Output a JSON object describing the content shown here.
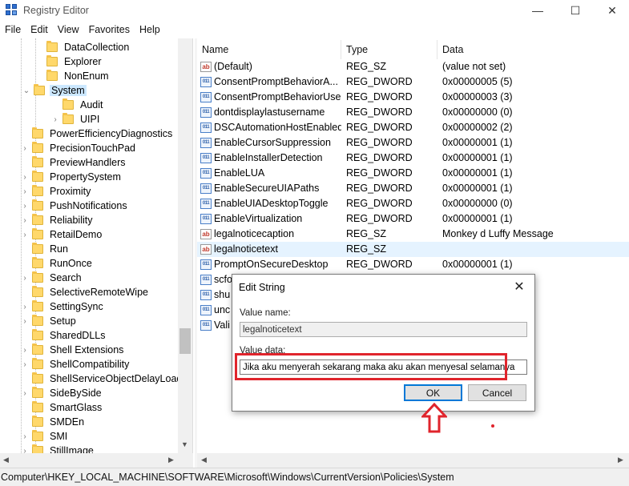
{
  "window": {
    "title": "Registry Editor",
    "minimize_glyph": "—",
    "maximize_glyph": "☐",
    "close_glyph": "✕"
  },
  "menu": [
    "File",
    "Edit",
    "View",
    "Favorites",
    "Help"
  ],
  "tree": {
    "items": [
      {
        "label": "DataCollection",
        "chevron": "",
        "selected": false
      },
      {
        "label": "Explorer",
        "chevron": "",
        "selected": false
      },
      {
        "label": "NonEnum",
        "chevron": "",
        "selected": false
      },
      {
        "label": "System",
        "chevron": "⌄",
        "selected": true
      },
      {
        "label": "Audit",
        "chevron": "",
        "selected": false
      },
      {
        "label": "UIPI",
        "chevron": "›",
        "selected": false
      },
      {
        "label": "PowerEfficiencyDiagnostics",
        "chevron": "",
        "selected": false
      },
      {
        "label": "PrecisionTouchPad",
        "chevron": "›",
        "selected": false
      },
      {
        "label": "PreviewHandlers",
        "chevron": "",
        "selected": false
      },
      {
        "label": "PropertySystem",
        "chevron": "›",
        "selected": false
      },
      {
        "label": "Proximity",
        "chevron": "›",
        "selected": false
      },
      {
        "label": "PushNotifications",
        "chevron": "›",
        "selected": false
      },
      {
        "label": "Reliability",
        "chevron": "›",
        "selected": false
      },
      {
        "label": "RetailDemo",
        "chevron": "›",
        "selected": false
      },
      {
        "label": "Run",
        "chevron": "",
        "selected": false
      },
      {
        "label": "RunOnce",
        "chevron": "",
        "selected": false
      },
      {
        "label": "Search",
        "chevron": "›",
        "selected": false
      },
      {
        "label": "SelectiveRemoteWipe",
        "chevron": "",
        "selected": false
      },
      {
        "label": "SettingSync",
        "chevron": "›",
        "selected": false
      },
      {
        "label": "Setup",
        "chevron": "›",
        "selected": false
      },
      {
        "label": "SharedDLLs",
        "chevron": "",
        "selected": false
      },
      {
        "label": "Shell Extensions",
        "chevron": "›",
        "selected": false
      },
      {
        "label": "ShellCompatibility",
        "chevron": "›",
        "selected": false
      },
      {
        "label": "ShellServiceObjectDelayLoad",
        "chevron": "",
        "selected": false
      },
      {
        "label": "SideBySide",
        "chevron": "›",
        "selected": false
      },
      {
        "label": "SmartGlass",
        "chevron": "",
        "selected": false
      },
      {
        "label": "SMDEn",
        "chevron": "",
        "selected": false
      },
      {
        "label": "SMI",
        "chevron": "›",
        "selected": false
      },
      {
        "label": "StillImage",
        "chevron": "›",
        "selected": false
      }
    ]
  },
  "list": {
    "columns": [
      "Name",
      "Type",
      "Data"
    ],
    "rows": [
      {
        "name": "(Default)",
        "kind": "sz",
        "type": "REG_SZ",
        "data": "(value not set)",
        "selected": false
      },
      {
        "name": "ConsentPromptBehaviorA...",
        "kind": "dword",
        "type": "REG_DWORD",
        "data": "0x00000005 (5)",
        "selected": false
      },
      {
        "name": "ConsentPromptBehaviorUser",
        "kind": "dword",
        "type": "REG_DWORD",
        "data": "0x00000003 (3)",
        "selected": false
      },
      {
        "name": "dontdisplaylastusername",
        "kind": "dword",
        "type": "REG_DWORD",
        "data": "0x00000000 (0)",
        "selected": false
      },
      {
        "name": "DSCAutomationHostEnabled",
        "kind": "dword",
        "type": "REG_DWORD",
        "data": "0x00000002 (2)",
        "selected": false
      },
      {
        "name": "EnableCursorSuppression",
        "kind": "dword",
        "type": "REG_DWORD",
        "data": "0x00000001 (1)",
        "selected": false
      },
      {
        "name": "EnableInstallerDetection",
        "kind": "dword",
        "type": "REG_DWORD",
        "data": "0x00000001 (1)",
        "selected": false
      },
      {
        "name": "EnableLUA",
        "kind": "dword",
        "type": "REG_DWORD",
        "data": "0x00000001 (1)",
        "selected": false
      },
      {
        "name": "EnableSecureUIAPaths",
        "kind": "dword",
        "type": "REG_DWORD",
        "data": "0x00000001 (1)",
        "selected": false
      },
      {
        "name": "EnableUIADesktopToggle",
        "kind": "dword",
        "type": "REG_DWORD",
        "data": "0x00000000 (0)",
        "selected": false
      },
      {
        "name": "EnableVirtualization",
        "kind": "dword",
        "type": "REG_DWORD",
        "data": "0x00000001 (1)",
        "selected": false
      },
      {
        "name": "legalnoticecaption",
        "kind": "sz",
        "type": "REG_SZ",
        "data": "Monkey d Luffy Message",
        "selected": false
      },
      {
        "name": "legalnoticetext",
        "kind": "sz",
        "type": "REG_SZ",
        "data": "",
        "selected": true
      },
      {
        "name": "PromptOnSecureDesktop",
        "kind": "dword",
        "type": "REG_DWORD",
        "data": "0x00000001 (1)",
        "selected": false
      },
      {
        "name": "scfo",
        "kind": "dword",
        "type": "",
        "data": "",
        "selected": false
      },
      {
        "name": "shu",
        "kind": "dword",
        "type": "",
        "data": "",
        "selected": false
      },
      {
        "name": "unc",
        "kind": "dword",
        "type": "",
        "data": "",
        "selected": false
      },
      {
        "name": "Vali",
        "kind": "dword",
        "type": "",
        "data": "",
        "selected": false
      }
    ]
  },
  "statusbar": {
    "path": "Computer\\HKEY_LOCAL_MACHINE\\SOFTWARE\\Microsoft\\Windows\\CurrentVersion\\Policies\\System"
  },
  "dialog": {
    "title": "Edit String",
    "close_glyph": "✕",
    "value_name_label": "Value name:",
    "value_name": "legalnoticetext",
    "value_data_label": "Value data:",
    "value_data": "Jika aku menyerah sekarang maka aku akan menyesal selamanya",
    "ok_label": "OK",
    "cancel_label": "Cancel"
  },
  "annotation": {
    "color": "#e0242c"
  },
  "colors": {
    "tree_selected": "#cce8ff",
    "list_selected": "#e5f3ff",
    "ok_focus_border": "#0078d7"
  }
}
